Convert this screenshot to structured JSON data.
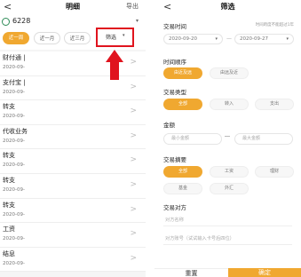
{
  "left": {
    "header": {
      "back": "<",
      "title": "明细",
      "export": "导出"
    },
    "account": {
      "number": "6228",
      "caret": "▾"
    },
    "periods": [
      {
        "label": "近一周",
        "active": true
      },
      {
        "label": "近一月",
        "active": false
      },
      {
        "label": "近三月",
        "active": false
      }
    ],
    "filter": {
      "label": "筛选",
      "dropdown": "▾"
    },
    "rows": [
      {
        "name": "财付通 |",
        "date": "2020-09-"
      },
      {
        "name": "支付宝 |",
        "date": "2020-09-"
      },
      {
        "name": "转支",
        "date": "2020-09-"
      },
      {
        "name": "代收业务",
        "date": "2020-09-"
      },
      {
        "name": "转支",
        "date": "2020-09-"
      },
      {
        "name": "转支",
        "date": "2020-09-"
      },
      {
        "name": "转支",
        "date": "2020-09-"
      },
      {
        "name": "工资",
        "date": "2020-09-"
      },
      {
        "name": "结息",
        "date": "2020-09-"
      }
    ],
    "chevron": ">"
  },
  "right": {
    "header": {
      "back": "<",
      "title": "筛选"
    },
    "time": {
      "label": "交易时间",
      "hint": "时间跨度不能超过1年",
      "start": "2020-09-20",
      "end": "2020-09-27",
      "separator": "—"
    },
    "order": {
      "label": "时间顺序",
      "options": [
        {
          "label": "由近及远",
          "active": true
        },
        {
          "label": "由远及近",
          "active": false
        }
      ]
    },
    "type": {
      "label": "交易类型",
      "options": [
        {
          "label": "全部",
          "active": true
        },
        {
          "label": "转入",
          "active": false
        },
        {
          "label": "支出",
          "active": false
        }
      ]
    },
    "amount": {
      "label": "金额",
      "min_placeholder": "最小金额",
      "max_placeholder": "最大金额"
    },
    "summary": {
      "label": "交易摘要",
      "options": [
        {
          "label": "全部",
          "active": true
        },
        {
          "label": "工资",
          "active": false
        },
        {
          "label": "理财",
          "active": false
        },
        {
          "label": "基金",
          "active": false
        },
        {
          "label": "外汇",
          "active": false
        }
      ]
    },
    "counterparty": {
      "label": "交易对方",
      "name_placeholder": "对方名称",
      "account_placeholder": "对方账号（试试输入卡号后四位）"
    },
    "buttons": {
      "reset": "重置",
      "confirm": "确定"
    }
  },
  "colors": {
    "accent": "#f0a830",
    "highlight": "#e0141e"
  }
}
